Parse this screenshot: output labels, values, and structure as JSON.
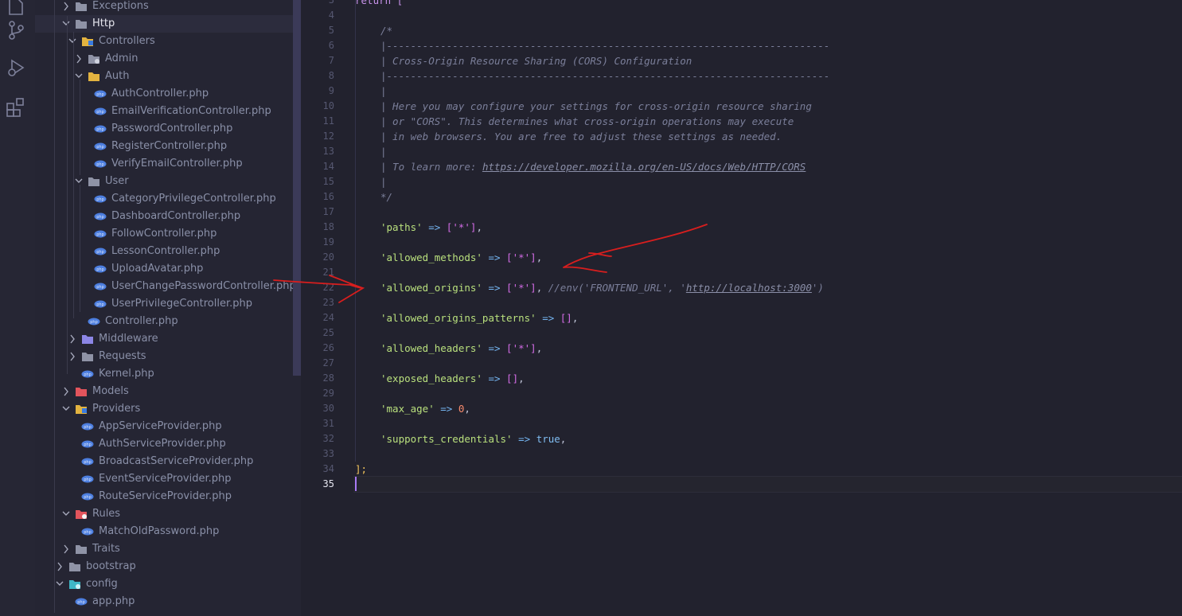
{
  "explorer": {
    "rows": [
      {
        "label": "Exceptions",
        "kind": "folder",
        "expanded": false
      },
      {
        "label": "Http",
        "kind": "folder",
        "expanded": true
      },
      {
        "label": "Controllers",
        "kind": "folder-special",
        "expanded": true
      },
      {
        "label": "Admin",
        "kind": "folder-admin",
        "expanded": false
      },
      {
        "label": "Auth",
        "kind": "folder-open",
        "expanded": true
      },
      {
        "label": "AuthController.php",
        "kind": "php"
      },
      {
        "label": "EmailVerificationController.php",
        "kind": "php"
      },
      {
        "label": "PasswordController.php",
        "kind": "php"
      },
      {
        "label": "RegisterController.php",
        "kind": "php"
      },
      {
        "label": "VerifyEmailController.php",
        "kind": "php"
      },
      {
        "label": "User",
        "kind": "folder",
        "expanded": true
      },
      {
        "label": "CategoryPrivilegeController.php",
        "kind": "php"
      },
      {
        "label": "DashboardController.php",
        "kind": "php"
      },
      {
        "label": "FollowController.php",
        "kind": "php"
      },
      {
        "label": "LessonController.php",
        "kind": "php"
      },
      {
        "label": "UploadAvatar.php",
        "kind": "php"
      },
      {
        "label": "UserChangePasswordController.php",
        "kind": "php"
      },
      {
        "label": "UserPrivilegeController.php",
        "kind": "php"
      },
      {
        "label": "Controller.php",
        "kind": "php"
      },
      {
        "label": "Middleware",
        "kind": "folder-middleware",
        "expanded": false
      },
      {
        "label": "Requests",
        "kind": "folder",
        "expanded": false
      },
      {
        "label": "Kernel.php",
        "kind": "php"
      },
      {
        "label": "Models",
        "kind": "folder-models",
        "expanded": false
      },
      {
        "label": "Providers",
        "kind": "folder-special",
        "expanded": true
      },
      {
        "label": "AppServiceProvider.php",
        "kind": "php"
      },
      {
        "label": "AuthServiceProvider.php",
        "kind": "php"
      },
      {
        "label": "BroadcastServiceProvider.php",
        "kind": "php"
      },
      {
        "label": "EventServiceProvider.php",
        "kind": "php"
      },
      {
        "label": "RouteServiceProvider.php",
        "kind": "php"
      },
      {
        "label": "Rules",
        "kind": "folder-rules",
        "expanded": true
      },
      {
        "label": "MatchOldPassword.php",
        "kind": "php"
      },
      {
        "label": "Traits",
        "kind": "folder",
        "expanded": false
      },
      {
        "label": "bootstrap",
        "kind": "folder",
        "expanded": false
      },
      {
        "label": "config",
        "kind": "folder-config",
        "expanded": true
      },
      {
        "label": "app.php",
        "kind": "php"
      }
    ]
  },
  "activity_bar": {
    "icons": [
      "source-control-icon",
      "run-debug-icon",
      "extensions-icon"
    ]
  },
  "editor": {
    "current_line": "35",
    "lines": [
      {
        "n": "3",
        "t": "return ["
      },
      {
        "n": "4",
        "t": ""
      },
      {
        "n": "5",
        "t": "/*"
      },
      {
        "n": "6",
        "t": "|--------------------------------------------------------------------------"
      },
      {
        "n": "7",
        "t": "| Cross-Origin Resource Sharing (CORS) Configuration"
      },
      {
        "n": "8",
        "t": "|--------------------------------------------------------------------------"
      },
      {
        "n": "9",
        "t": "|"
      },
      {
        "n": "10",
        "t": "| Here you may configure your settings for cross-origin resource sharing"
      },
      {
        "n": "11",
        "t": "| or \"CORS\". This determines what cross-origin operations may execute"
      },
      {
        "n": "12",
        "t": "| in web browsers. You are free to adjust these settings as needed."
      },
      {
        "n": "13",
        "t": "|"
      },
      {
        "n": "14",
        "t": "| To learn more: ",
        "link": "https://developer.mozilla.org/en-US/docs/Web/HTTP/CORS"
      },
      {
        "n": "15",
        "t": "|"
      },
      {
        "n": "16",
        "t": "*/"
      },
      {
        "n": "17",
        "t": ""
      },
      {
        "n": "18",
        "key": "'paths'",
        "val": "['*']"
      },
      {
        "n": "19",
        "t": ""
      },
      {
        "n": "20",
        "key": "'allowed_methods'",
        "val": "['*']"
      },
      {
        "n": "21",
        "t": ""
      },
      {
        "n": "22",
        "key": "'allowed_origins'",
        "val": "['*']",
        "comment_pre": "//env(",
        "comment_str1": "'FRONTEND_URL'",
        "comment_mid": ", ",
        "comment_link": "http://localhost:3000",
        "comment_post": "')"
      },
      {
        "n": "23",
        "t": ""
      },
      {
        "n": "24",
        "key": "'allowed_origins_patterns'",
        "val": "[]"
      },
      {
        "n": "25",
        "t": ""
      },
      {
        "n": "26",
        "key": "'allowed_headers'",
        "val": "['*']"
      },
      {
        "n": "27",
        "t": ""
      },
      {
        "n": "28",
        "key": "'exposed_headers'",
        "val": "[]"
      },
      {
        "n": "29",
        "t": ""
      },
      {
        "n": "30",
        "key": "'max_age'",
        "num": "0"
      },
      {
        "n": "31",
        "t": ""
      },
      {
        "n": "32",
        "key": "'supports_credentials'",
        "bool": "true"
      },
      {
        "n": "33",
        "t": ""
      },
      {
        "n": "34",
        "t": "];"
      },
      {
        "n": "35",
        "t": ""
      }
    ]
  }
}
